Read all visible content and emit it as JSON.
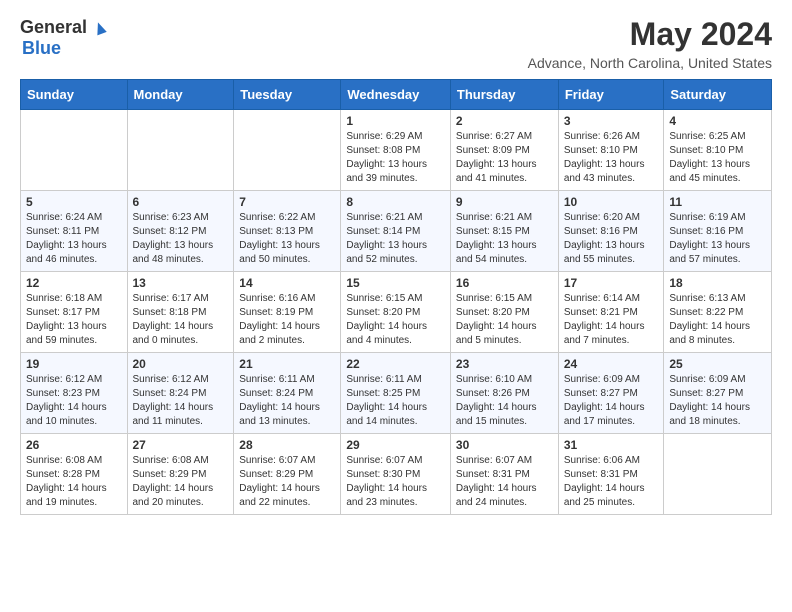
{
  "logo": {
    "general": "General",
    "blue": "Blue"
  },
  "title": {
    "month_year": "May 2024",
    "location": "Advance, North Carolina, United States"
  },
  "days_of_week": [
    "Sunday",
    "Monday",
    "Tuesday",
    "Wednesday",
    "Thursday",
    "Friday",
    "Saturday"
  ],
  "weeks": [
    [
      {
        "day": "",
        "info": ""
      },
      {
        "day": "",
        "info": ""
      },
      {
        "day": "",
        "info": ""
      },
      {
        "day": "1",
        "info": "Sunrise: 6:29 AM\nSunset: 8:08 PM\nDaylight: 13 hours and 39 minutes."
      },
      {
        "day": "2",
        "info": "Sunrise: 6:27 AM\nSunset: 8:09 PM\nDaylight: 13 hours and 41 minutes."
      },
      {
        "day": "3",
        "info": "Sunrise: 6:26 AM\nSunset: 8:10 PM\nDaylight: 13 hours and 43 minutes."
      },
      {
        "day": "4",
        "info": "Sunrise: 6:25 AM\nSunset: 8:10 PM\nDaylight: 13 hours and 45 minutes."
      }
    ],
    [
      {
        "day": "5",
        "info": "Sunrise: 6:24 AM\nSunset: 8:11 PM\nDaylight: 13 hours and 46 minutes."
      },
      {
        "day": "6",
        "info": "Sunrise: 6:23 AM\nSunset: 8:12 PM\nDaylight: 13 hours and 48 minutes."
      },
      {
        "day": "7",
        "info": "Sunrise: 6:22 AM\nSunset: 8:13 PM\nDaylight: 13 hours and 50 minutes."
      },
      {
        "day": "8",
        "info": "Sunrise: 6:21 AM\nSunset: 8:14 PM\nDaylight: 13 hours and 52 minutes."
      },
      {
        "day": "9",
        "info": "Sunrise: 6:21 AM\nSunset: 8:15 PM\nDaylight: 13 hours and 54 minutes."
      },
      {
        "day": "10",
        "info": "Sunrise: 6:20 AM\nSunset: 8:16 PM\nDaylight: 13 hours and 55 minutes."
      },
      {
        "day": "11",
        "info": "Sunrise: 6:19 AM\nSunset: 8:16 PM\nDaylight: 13 hours and 57 minutes."
      }
    ],
    [
      {
        "day": "12",
        "info": "Sunrise: 6:18 AM\nSunset: 8:17 PM\nDaylight: 13 hours and 59 minutes."
      },
      {
        "day": "13",
        "info": "Sunrise: 6:17 AM\nSunset: 8:18 PM\nDaylight: 14 hours and 0 minutes."
      },
      {
        "day": "14",
        "info": "Sunrise: 6:16 AM\nSunset: 8:19 PM\nDaylight: 14 hours and 2 minutes."
      },
      {
        "day": "15",
        "info": "Sunrise: 6:15 AM\nSunset: 8:20 PM\nDaylight: 14 hours and 4 minutes."
      },
      {
        "day": "16",
        "info": "Sunrise: 6:15 AM\nSunset: 8:20 PM\nDaylight: 14 hours and 5 minutes."
      },
      {
        "day": "17",
        "info": "Sunrise: 6:14 AM\nSunset: 8:21 PM\nDaylight: 14 hours and 7 minutes."
      },
      {
        "day": "18",
        "info": "Sunrise: 6:13 AM\nSunset: 8:22 PM\nDaylight: 14 hours and 8 minutes."
      }
    ],
    [
      {
        "day": "19",
        "info": "Sunrise: 6:12 AM\nSunset: 8:23 PM\nDaylight: 14 hours and 10 minutes."
      },
      {
        "day": "20",
        "info": "Sunrise: 6:12 AM\nSunset: 8:24 PM\nDaylight: 14 hours and 11 minutes."
      },
      {
        "day": "21",
        "info": "Sunrise: 6:11 AM\nSunset: 8:24 PM\nDaylight: 14 hours and 13 minutes."
      },
      {
        "day": "22",
        "info": "Sunrise: 6:11 AM\nSunset: 8:25 PM\nDaylight: 14 hours and 14 minutes."
      },
      {
        "day": "23",
        "info": "Sunrise: 6:10 AM\nSunset: 8:26 PM\nDaylight: 14 hours and 15 minutes."
      },
      {
        "day": "24",
        "info": "Sunrise: 6:09 AM\nSunset: 8:27 PM\nDaylight: 14 hours and 17 minutes."
      },
      {
        "day": "25",
        "info": "Sunrise: 6:09 AM\nSunset: 8:27 PM\nDaylight: 14 hours and 18 minutes."
      }
    ],
    [
      {
        "day": "26",
        "info": "Sunrise: 6:08 AM\nSunset: 8:28 PM\nDaylight: 14 hours and 19 minutes."
      },
      {
        "day": "27",
        "info": "Sunrise: 6:08 AM\nSunset: 8:29 PM\nDaylight: 14 hours and 20 minutes."
      },
      {
        "day": "28",
        "info": "Sunrise: 6:07 AM\nSunset: 8:29 PM\nDaylight: 14 hours and 22 minutes."
      },
      {
        "day": "29",
        "info": "Sunrise: 6:07 AM\nSunset: 8:30 PM\nDaylight: 14 hours and 23 minutes."
      },
      {
        "day": "30",
        "info": "Sunrise: 6:07 AM\nSunset: 8:31 PM\nDaylight: 14 hours and 24 minutes."
      },
      {
        "day": "31",
        "info": "Sunrise: 6:06 AM\nSunset: 8:31 PM\nDaylight: 14 hours and 25 minutes."
      },
      {
        "day": "",
        "info": ""
      }
    ]
  ]
}
